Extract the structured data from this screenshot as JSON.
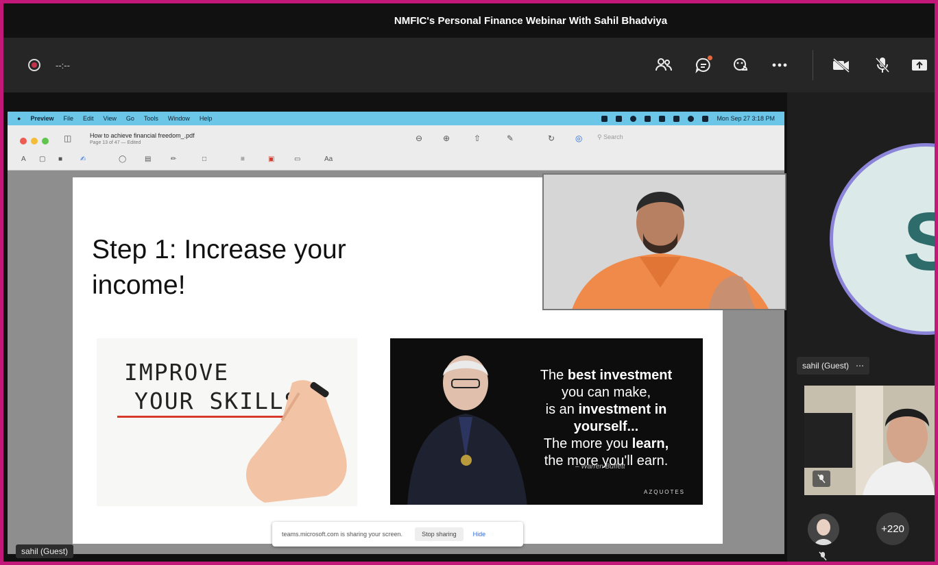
{
  "window": {
    "title": "NMFIC's Personal Finance Webinar With Sahil Bhadviya"
  },
  "toolbar": {
    "recording_time": "--:--",
    "buttons": [
      "participants-icon",
      "chat-icon",
      "reactions-icon",
      "more-icon",
      "camera-off-icon",
      "mic-off-icon",
      "share-icon"
    ]
  },
  "shared_screen": {
    "mac_menu": {
      "app": "Preview",
      "items": [
        "File",
        "Edit",
        "View",
        "Go",
        "Tools",
        "Window",
        "Help"
      ],
      "clock": "Mon Sep 27  3:18 PM"
    },
    "preview": {
      "doc_title": "How to achieve financial freedom_.pdf",
      "doc_sub": "Page 13 of 47 — Edited",
      "search_placeholder": "Search"
    },
    "slide": {
      "heading": "Step 1: Increase your income!",
      "skills_line1": "IMPROVE",
      "skills_line2": "YOUR SKILLS !",
      "quote_parts": {
        "l1a": "The ",
        "l1b": "best investment",
        "l2": "you can make,",
        "l3a": "is an ",
        "l3b": "investment in yourself...",
        "l4a": "The more you ",
        "l4b": "learn,",
        "l5": "the more you'll earn."
      },
      "quote_author": "– Warren Buffett",
      "quote_brand": "AZQUOTES"
    },
    "share_notice": {
      "message": "teams.microsoft.com is sharing your screen.",
      "stop": "Stop sharing",
      "hide": "Hide"
    },
    "presenter_label": "sahil (Guest)"
  },
  "right_panel": {
    "avatar_letter": "S",
    "guest_name": "sahil (Guest)",
    "more_participants": "+220"
  },
  "colors": {
    "accent": "#8c84d8",
    "record": "#c4314b",
    "frame": "#c2187a"
  }
}
